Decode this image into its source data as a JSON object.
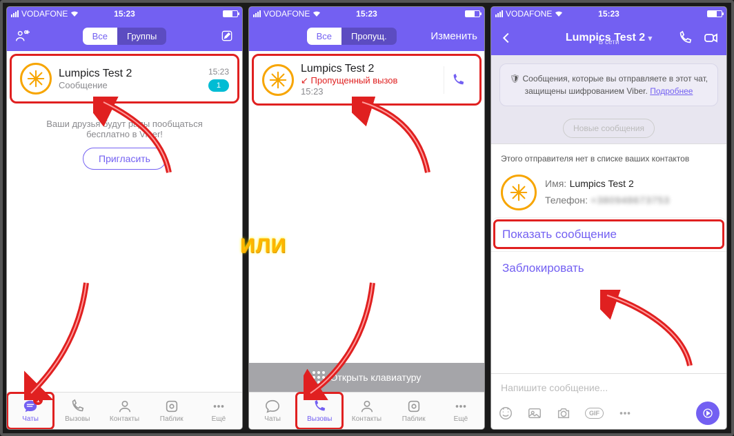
{
  "status": {
    "carrier": "VODAFONE",
    "time": "15:23"
  },
  "seg": {
    "all": "Все",
    "groups": "Группы",
    "missed": "Пропущ."
  },
  "editLabel": "Изменить",
  "contactName": "Lumpics Test 2",
  "screen1": {
    "sub": "Сообщение",
    "time": "15:23",
    "badge": "1",
    "inviteText": "Ваши друзья будут рады пообщаться бесплатно в Viber!",
    "inviteBtn": "Пригласить"
  },
  "screen2": {
    "sub": "Пропущенный вызов",
    "subTime": "15:23",
    "dial": "Открыть клавиатуру"
  },
  "screen3": {
    "status": "В сети",
    "notice": "Сообщения, которые вы отправляете в этот чат, защищены шифрованием Viber.",
    "noticeLink": "Подробнее",
    "newmsg": "Новые сообщения",
    "sheetTitle": "Этого отправителя нет в списке ваших контактов",
    "nameLabel": "Имя:",
    "phoneLabel": "Телефон:",
    "phoneVal": "+380948673753",
    "showMsg": "Показать сообщение",
    "block": "Заблокировать",
    "placeholder": "Напишите сообщение..."
  },
  "tabs": {
    "chats": "Чаты",
    "calls": "Вызовы",
    "contacts": "Контакты",
    "public": "Паблик",
    "more": "Ещё",
    "badge": "1"
  },
  "or": "ИЛИ",
  "icons": {
    "shield": "shield-icon",
    "chevron": "chevron-down-icon"
  }
}
